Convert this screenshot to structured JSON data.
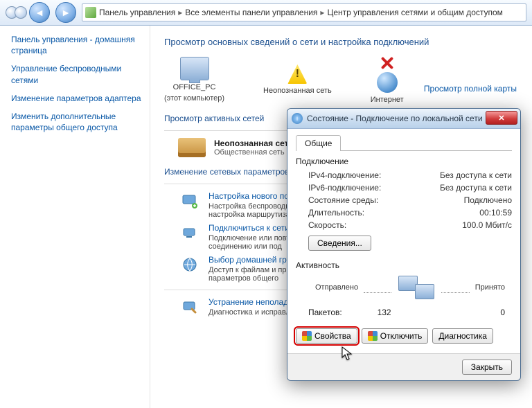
{
  "breadcrumb": {
    "root": "Панель управления",
    "mid": "Все элементы панели управления",
    "leaf": "Центр управления сетями и общим доступом"
  },
  "sidebar": {
    "home": "Панель управления - домашняя страница",
    "wireless": "Управление беспроводными сетями",
    "adapter": "Изменение параметров адаптера",
    "sharing": "Изменить дополнительные параметры общего доступа"
  },
  "main": {
    "title": "Просмотр основных сведений о сети и настройка подключений",
    "maplink": "Просмотр полной карты",
    "nodes": {
      "pc_name": "OFFICE_PC",
      "pc_sub": "(этот компьютер)",
      "unknown": "Неопознанная сеть",
      "internet": "Интернет"
    },
    "active_heading": "Просмотр активных сетей",
    "active": {
      "name": "Неопознанная сеть",
      "type": "Общественная сеть"
    },
    "params_heading": "Изменение сетевых параметров",
    "p1": {
      "title": "Настройка нового подключе",
      "desc": "Настройка беспроводного, ши или же настройка маршрутиза"
    },
    "p2": {
      "title": "Подключиться к сети",
      "desc": "Подключение или повторное по сетевому соединению или под"
    },
    "p3": {
      "title": "Выбор домашней группы и пар",
      "desc": "Доступ к файлам и принтерам, изменение параметров общего"
    },
    "p4": {
      "title": "Устранение неполадок",
      "desc": "Диагностика и исправление сет"
    }
  },
  "dialog": {
    "title": "Состояние - Подключение по локальной сети",
    "tab": "Общие",
    "conn_label": "Подключение",
    "rows": {
      "ipv4_k": "IPv4-подключение:",
      "ipv4_v": "Без доступа к сети",
      "ipv6_k": "IPv6-подключение:",
      "ipv6_v": "Без доступа к сети",
      "media_k": "Состояние среды:",
      "media_v": "Подключено",
      "dur_k": "Длительность:",
      "dur_v": "00:10:59",
      "speed_k": "Скорость:",
      "speed_v": "100.0 Мбит/с"
    },
    "details_btn": "Сведения...",
    "activity_label": "Активность",
    "sent_label": "Отправлено",
    "recv_label": "Принято",
    "packets_label": "Пакетов:",
    "packets_sent": "132",
    "packets_recv": "0",
    "btn_props": "Свойства",
    "btn_disable": "Отключить",
    "btn_diag": "Диагностика",
    "btn_close": "Закрыть"
  }
}
